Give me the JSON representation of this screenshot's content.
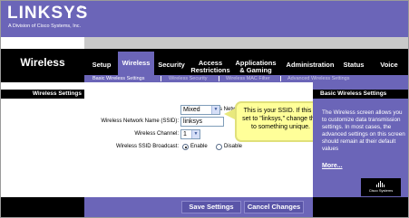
{
  "brand": {
    "logo": "LINKSYS",
    "trademark": "®",
    "subtitle": "A Division of Cisco Systems, Inc."
  },
  "section_title": "Wireless",
  "tabs": [
    {
      "label": "Setup",
      "active": false
    },
    {
      "label": "Wireless",
      "active": true
    },
    {
      "label": "Security",
      "active": false
    },
    {
      "label": "Access\nRestrictions",
      "active": false
    },
    {
      "label": "Applications\n& Gaming",
      "active": false
    },
    {
      "label": "Administration",
      "active": false
    },
    {
      "label": "Status",
      "active": false
    },
    {
      "label": "Voice",
      "active": false
    }
  ],
  "subtabs": [
    {
      "label": "Basic Wireless Settings",
      "active": true
    },
    {
      "label": "Wireless Security",
      "active": false
    },
    {
      "label": "Wireless MAC Filter",
      "active": false
    },
    {
      "label": "Advanced Wireless Settings",
      "active": false
    }
  ],
  "left_heading": "Wireless Settings",
  "form": {
    "mode_label": "Wireless Network Mode:",
    "mode_value": "Mixed",
    "ssid_label": "Wireless Network Name (SSID):",
    "ssid_value": "linksys",
    "channel_label": "Wireless Channel:",
    "channel_value": "1",
    "broadcast_label": "Wireless SSID Broadcast:",
    "broadcast_options": [
      "Enable",
      "Disable"
    ],
    "broadcast_selected": "Enable"
  },
  "tooltip": "This is your SSID. If this is set to \"linksys,\" change this to something unique.",
  "help": {
    "heading": "Basic Wireless Settings",
    "text": "The Wireless screen allows you to customize data transmission settings. In most cases, the advanced settings on this screen should remain at their default values",
    "more": "More..."
  },
  "cisco_logo": "Cisco Systems",
  "buttons": {
    "save": "Save Settings",
    "cancel": "Cancel Changes"
  },
  "colors": {
    "brand_purple": "#6b65b8",
    "tooltip_yellow": "#ffff99"
  }
}
